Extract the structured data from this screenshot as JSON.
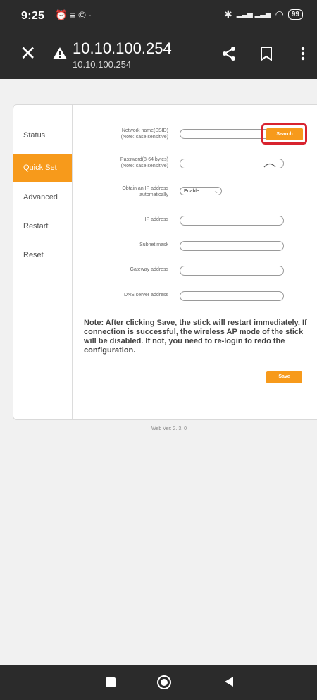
{
  "status_bar": {
    "time": "9:25",
    "left_icons": "⏰ ≡ © ·",
    "bluetooth": "✱",
    "signal": "▂▃▅ ▂▃▅",
    "wifi": "◠",
    "battery": "99"
  },
  "browser": {
    "url_main": "10.10.100.254",
    "url_sub": "10.10.100.254"
  },
  "sidenav": {
    "items": [
      {
        "label": "Status"
      },
      {
        "label": "Quick Set"
      },
      {
        "label": "Advanced"
      },
      {
        "label": "Restart"
      },
      {
        "label": "Reset"
      }
    ]
  },
  "form": {
    "ssid_label_1": "Network name(SSID)",
    "ssid_label_2": "(Note: case sensitive)",
    "ssid_value": "",
    "search_label": "Search",
    "password_label_1": "Password(8-64 bytes)",
    "password_label_2": "(Note: case sensitive)",
    "password_value": "",
    "obtain_label_1": "Obtain an IP address",
    "obtain_label_2": "automatically",
    "obtain_value": "Enable",
    "ip_label": "IP address",
    "ip_value": "",
    "subnet_label": "Subnet mask",
    "subnet_value": "",
    "gateway_label": "Gateway address",
    "gateway_value": "",
    "dns_label": "DNS server address",
    "dns_value": ""
  },
  "note": "Note: After clicking Save, the stick will restart immediately. If connection is successful, the wireless AP mode of the stick will be disabled. If not, you need to re-login to redo the configuration.",
  "save_label": "Save",
  "web_version": "Web Ver: 2. 3. 0",
  "colors": {
    "accent": "#f79a1b",
    "highlight": "#d8232f",
    "chrome": "#2b2b2b"
  }
}
